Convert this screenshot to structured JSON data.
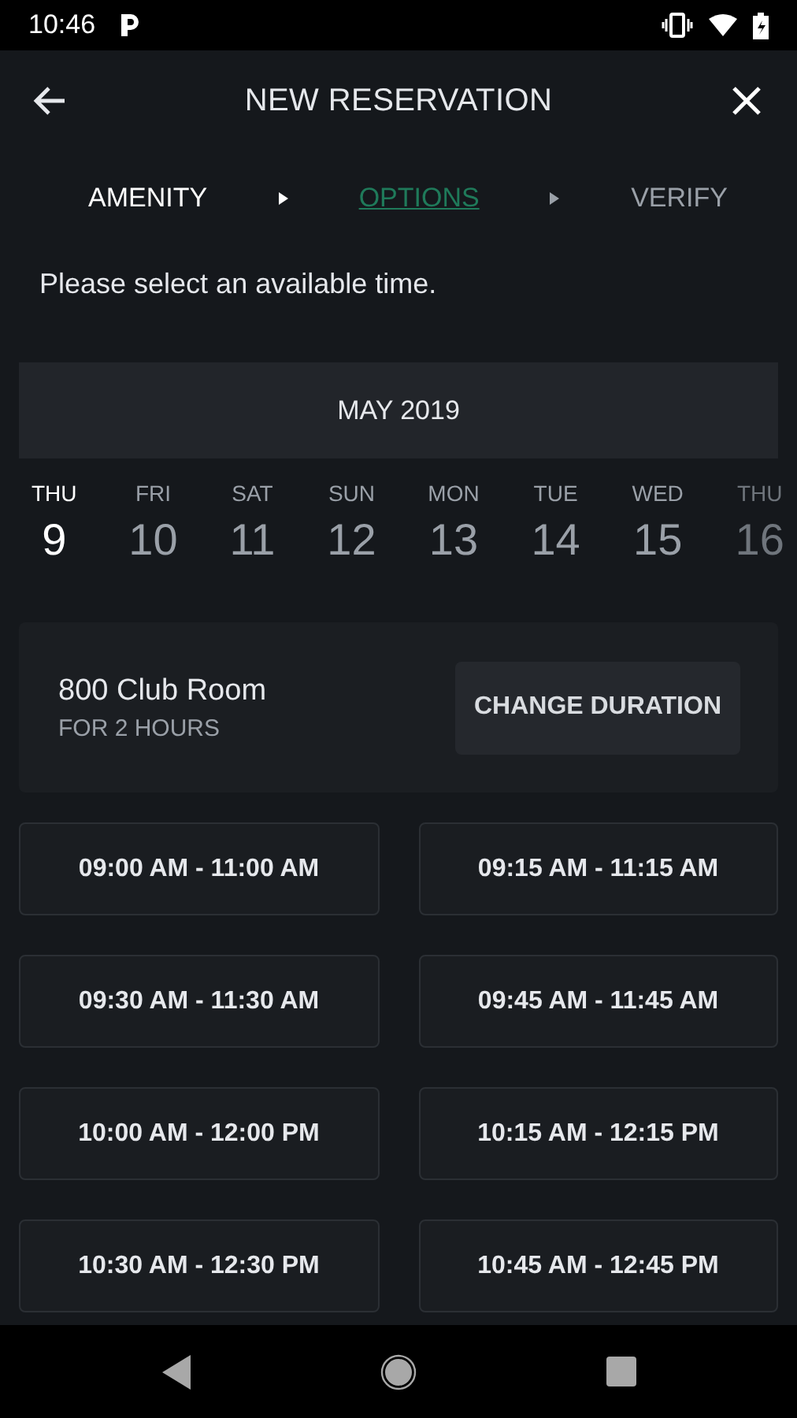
{
  "status_bar": {
    "time": "10:46"
  },
  "header": {
    "title": "NEW RESERVATION"
  },
  "steps": [
    {
      "label": "AMENITY",
      "kind": "done"
    },
    {
      "label": "OPTIONS",
      "kind": "current"
    },
    {
      "label": "VERIFY",
      "kind": "pending"
    }
  ],
  "prompt": "Please select an available time.",
  "calendar": {
    "month": "MAY 2019",
    "days": [
      {
        "weekday": "THU",
        "date": "9",
        "selected": true
      },
      {
        "weekday": "FRI",
        "date": "10",
        "selected": false
      },
      {
        "weekday": "SAT",
        "date": "11",
        "selected": false
      },
      {
        "weekday": "SUN",
        "date": "12",
        "selected": false
      },
      {
        "weekday": "MON",
        "date": "13",
        "selected": false
      },
      {
        "weekday": "TUE",
        "date": "14",
        "selected": false
      },
      {
        "weekday": "WED",
        "date": "15",
        "selected": false
      },
      {
        "weekday": "THU",
        "date": "16",
        "selected": false
      }
    ]
  },
  "amenity": {
    "name": "800 Club Room",
    "duration": "FOR 2 HOURS",
    "button": "CHANGE DURATION"
  },
  "slots": [
    "09:00 AM - 11:00 AM",
    "09:15 AM - 11:15 AM",
    "09:30 AM - 11:30 AM",
    "09:45 AM - 11:45 AM",
    "10:00 AM - 12:00 PM",
    "10:15 AM - 12:15 PM",
    "10:30 AM - 12:30 PM",
    "10:45 AM - 12:45 PM"
  ]
}
